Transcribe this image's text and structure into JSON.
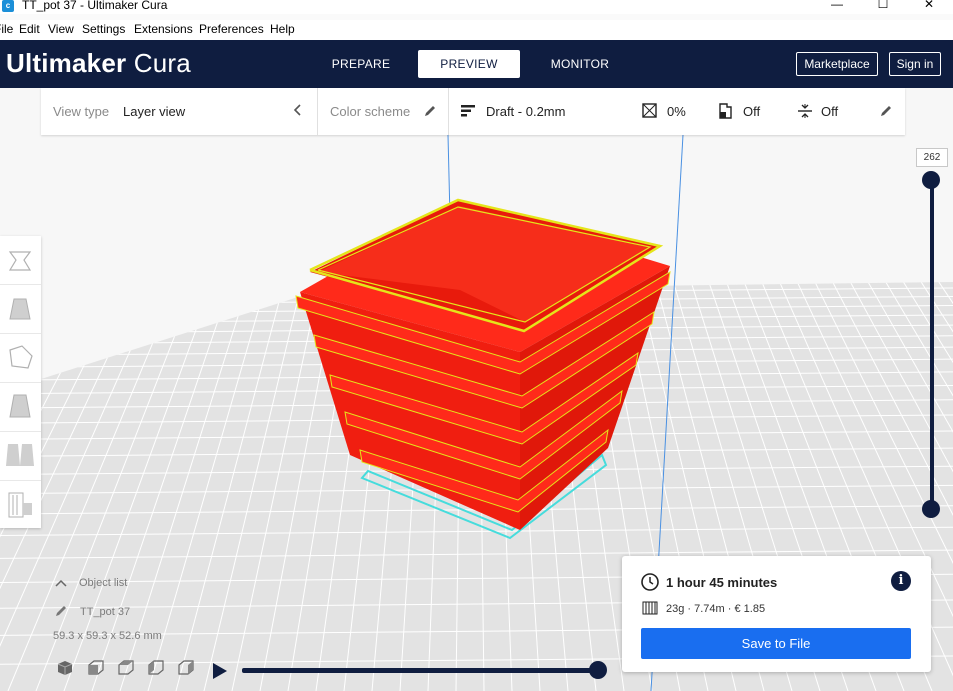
{
  "window": {
    "title": "TT_pot 37 - Ultimaker Cura",
    "minimize": "—",
    "maximize": "☐",
    "close": "✕"
  },
  "menu": {
    "items": [
      "File",
      "Edit",
      "View",
      "Settings",
      "Extensions",
      "Preferences",
      "Help"
    ]
  },
  "header": {
    "logo_brand": "Ultimaker",
    "logo_product": "Cura",
    "tabs": [
      {
        "label": "PREPARE",
        "active": false
      },
      {
        "label": "PREVIEW",
        "active": true
      },
      {
        "label": "MONITOR",
        "active": false
      }
    ],
    "marketplace": "Marketplace",
    "sign_in": "Sign in"
  },
  "view_bar": {
    "view_type_label": "View type",
    "view_type_value": "Layer view",
    "color_scheme_label": "Color scheme",
    "profile": "Draft - 0.2mm",
    "infill": "0%",
    "support": "Off",
    "adhesion": "Off"
  },
  "layer_slider": {
    "current_layer": "262",
    "level": 1.0
  },
  "object_list": {
    "header": "Object list",
    "object_name": "TT_pot 37",
    "dimensions": "59.3 x 59.3 x 52.6 mm"
  },
  "print_info": {
    "time": "1 hour 45 minutes",
    "material": "23g · 7.74m · € 1.85",
    "save_button": "Save to File"
  },
  "playback": {
    "progress": 1.0
  },
  "colors": {
    "header_bg": "#0f1d40",
    "accent_blue": "#196ef0",
    "model_red": "#ff2a1a",
    "wall_yellow": "#e5e51a",
    "skirt_cyan": "#46dcdc"
  }
}
